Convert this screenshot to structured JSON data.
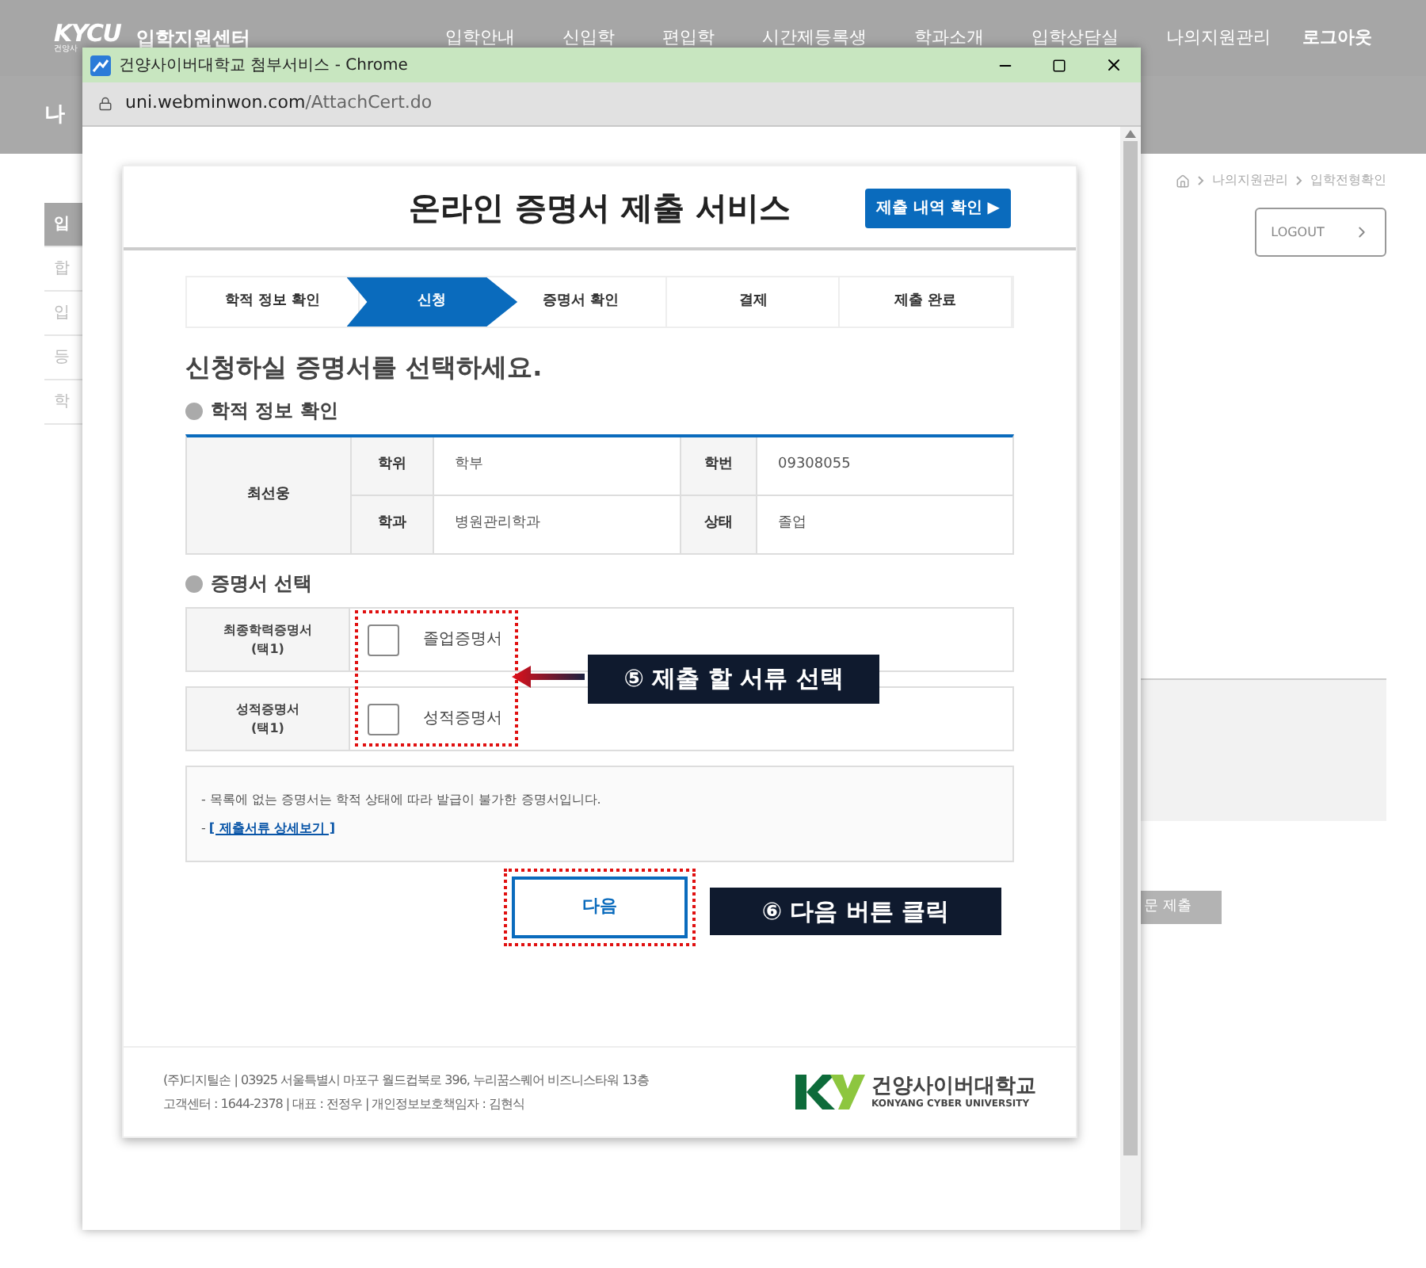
{
  "site": {
    "logo": "KYCU",
    "logo_sub": "건양사",
    "title": "입학지원센터",
    "nav": [
      "입학안내",
      "신입학",
      "편입학",
      "시간제등록생",
      "학과소개",
      "입학상담실",
      "나의지원관리"
    ],
    "logout": "로그아웃",
    "page_title": "나",
    "sidebar": [
      {
        "label": "입",
        "selected": true
      },
      {
        "label": "합",
        "selected": false
      },
      {
        "label": "입",
        "selected": false
      },
      {
        "label": "등",
        "selected": false
      },
      {
        "label": "학",
        "selected": false
      }
    ],
    "breadcrumb": [
      "나의지원관리",
      "입학전형확인"
    ],
    "logout_button": "LOGOUT",
    "visit_button": "문 제출"
  },
  "popup": {
    "title": "건양사이버대학교 첨부서비스 - Chrome",
    "url_host": "uni.webminwon.com",
    "url_path": "/AttachCert.do",
    "heading": "온라인 증명서 제출 서비스",
    "history_button": "제출 내역 확인 ▶",
    "steps": [
      {
        "label": "학적 정보 확인",
        "selected": false
      },
      {
        "label": "신청",
        "selected": true
      },
      {
        "label": "증명서 확인",
        "selected": false
      },
      {
        "label": "결제",
        "selected": false
      },
      {
        "label": "제출 완료",
        "selected": false
      }
    ],
    "instruction": "신청하실 증명서를 선택하세요.",
    "info_title": "학적 정보 확인",
    "student": {
      "name": "최선웅",
      "fields": [
        {
          "label": "학위",
          "value": "학부"
        },
        {
          "label": "학번",
          "value": "09308055"
        },
        {
          "label": "학과",
          "value": "병원관리학과"
        },
        {
          "label": "상태",
          "value": "졸업"
        }
      ]
    },
    "cert_title": "증명서 선택",
    "certs": [
      {
        "category": "최종학력증명서",
        "note": "(택1)",
        "option": "졸업증명서",
        "checked": false
      },
      {
        "category": "성적증명서",
        "note": "(택1)",
        "option": "성적증명서",
        "checked": false
      }
    ],
    "notes": [
      "- 목록에 없는 증명서는 학적 상태에 따라 발급이 불가한 증명서입니다."
    ],
    "detail_link_prefix": "-",
    "detail_link": "[ 제출서류 상세보기 ]",
    "next_button": "다음",
    "callouts": [
      "⑤ 제출 할 서류 선택",
      "⑥ 다음 버튼 클릭"
    ],
    "footer": [
      "(주)디지틸손 | 03925 서울특별시 마포구 월드컵북로 396, 누리꿈스퀘어 비즈니스타워 13층",
      "고객센터 : 1644-2378 | 대표 : 전정우 | 개인정보보호책임자 : 김현식"
    ],
    "brand": "건양사이버대학교",
    "brand_en": "KONYANG CYBER UNIVERSITY"
  }
}
